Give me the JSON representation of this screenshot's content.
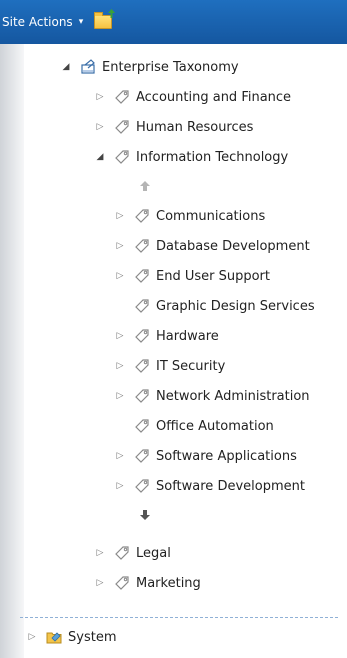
{
  "ribbon": {
    "site_actions_label": "Site Actions",
    "site_actions_caret": "▾",
    "folder_icon": "folder-plus-icon"
  },
  "tree": {
    "root": {
      "label": "Enterprise Taxonomy",
      "expanded": true
    },
    "level1": [
      {
        "label": "Accounting and Finance",
        "expanded": false
      },
      {
        "label": "Human Resources",
        "expanded": false
      },
      {
        "label": "Information Technology",
        "expanded": true
      }
    ],
    "it_children": [
      {
        "label": "Communications",
        "has_children": true
      },
      {
        "label": "Database Development",
        "has_children": true
      },
      {
        "label": "End User Support",
        "has_children": true
      },
      {
        "label": "Graphic Design Services",
        "has_children": false
      },
      {
        "label": "Hardware",
        "has_children": true
      },
      {
        "label": "IT Security",
        "has_children": true
      },
      {
        "label": "Network Administration",
        "has_children": true
      },
      {
        "label": "Office Automation",
        "has_children": false
      },
      {
        "label": "Software Applications",
        "has_children": true
      },
      {
        "label": "Software Development",
        "has_children": true
      }
    ],
    "level1_after": [
      {
        "label": "Legal",
        "expanded": false
      },
      {
        "label": "Marketing",
        "expanded": false
      }
    ],
    "system": {
      "label": "System",
      "expanded": false
    }
  },
  "colors": {
    "ribbon": "#1a63b0",
    "tag_stroke": "#8a8a8a",
    "separator": "#8fb0d6"
  }
}
